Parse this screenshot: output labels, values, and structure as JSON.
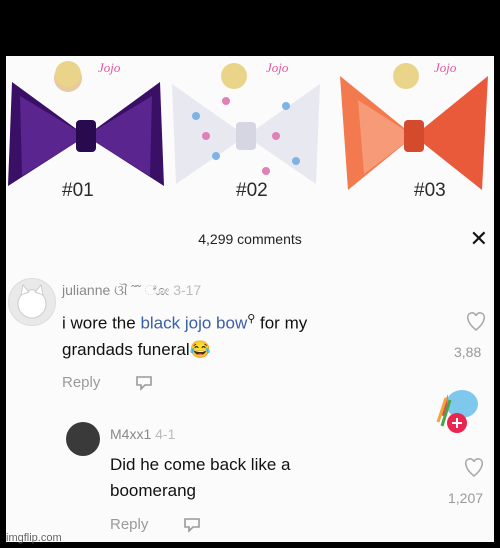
{
  "bows": [
    {
      "number": "#01",
      "color": "#4b1a78"
    },
    {
      "number": "#02",
      "color": "#ececf3"
    },
    {
      "number": "#03",
      "color": "#ef6a48"
    }
  ],
  "comments_header": {
    "count_label": "4,299 comments"
  },
  "comment1": {
    "username": "julianne",
    "username_extra": "ଔ ˜˜ ೋ",
    "date": "3-17",
    "text_line1_pre": "i wore the ",
    "text_link": "black jojo bow",
    "text_line1_post": " for my",
    "text_line2": "grandads funeral",
    "emoji": "😂",
    "reply_label": "Reply",
    "like_count": "3,88"
  },
  "comment2": {
    "username": "M4xx1",
    "date": "4-1",
    "text_line1": "Did he come back like a",
    "text_line2": "boomerang",
    "reply_label": "Reply",
    "like_count": "1,207"
  },
  "watermark": "imgflip.com"
}
